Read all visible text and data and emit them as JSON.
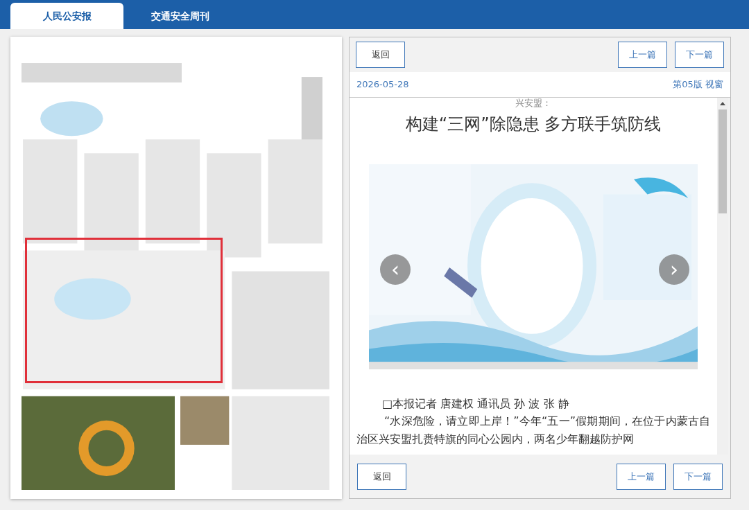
{
  "tabs": [
    {
      "label": "人民公安报",
      "selected": true
    },
    {
      "label": "交通安全周刊",
      "selected": false
    }
  ],
  "page_view": {
    "highlight": true
  },
  "article": {
    "top_buttons": [
      "返回",
      "上一篇",
      "下一篇"
    ],
    "date": "2026-05-28",
    "section": "第05版 视窗",
    "kicker": "兴安盟：",
    "title": "构建“三网”除隐患 多方联手筑防线",
    "figure": {
      "prev": "‹",
      "next": "›"
    },
    "byline": "□本报记者 唐建权 通讯员 孙 波 张 静",
    "paragraph": "“水深危险，请立即上岸！”今年“五一”假期期间，在位于内蒙古自治区兴安盟扎赉特旗的同心公园内，两名少年翻越防护网",
    "bottom_buttons": [
      "返回",
      "上一篇",
      "下一篇"
    ]
  }
}
